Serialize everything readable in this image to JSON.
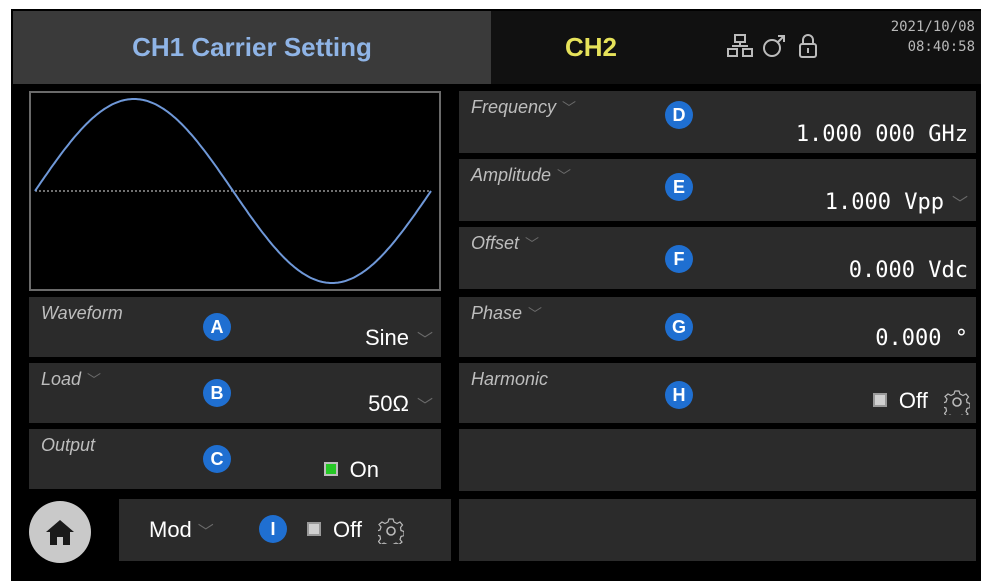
{
  "header": {
    "ch1_title": "CH1 Carrier Setting",
    "ch2_tab": "CH2",
    "date": "2021/10/08",
    "time": "08:40:58",
    "status_icons": [
      "network-icon",
      "usb-icon",
      "lock-icon"
    ]
  },
  "waveform_preview": {
    "shape": "sine",
    "color": "#6f98d8",
    "cycles": 1
  },
  "left_params": {
    "waveform": {
      "label": "Waveform",
      "value": "Sine",
      "badge": "A"
    },
    "load": {
      "label": "Load",
      "value": "50Ω",
      "badge": "B"
    },
    "output": {
      "label": "Output",
      "value": "On",
      "badge": "C",
      "state": "on"
    }
  },
  "right_params": {
    "frequency": {
      "label": "Frequency",
      "value": "1.000 000 GHz",
      "badge": "D"
    },
    "amplitude": {
      "label": "Amplitude",
      "value": "1.000 Vpp",
      "badge": "E"
    },
    "offset": {
      "label": "Offset",
      "value": "0.000 Vdc",
      "badge": "F"
    },
    "phase": {
      "label": "Phase",
      "value": "0.000 °",
      "badge": "G"
    },
    "harmonic": {
      "label": "Harmonic",
      "value": "Off",
      "badge": "H",
      "state": "off"
    }
  },
  "bottom": {
    "mod_label": "Mod",
    "mod_badge": "I",
    "mod_state": "Off"
  },
  "colors": {
    "accent_badge": "#1f6fd1",
    "ch1_text": "#8fb4e6",
    "ch2_text": "#e6e25a",
    "output_on": "#26c826"
  }
}
